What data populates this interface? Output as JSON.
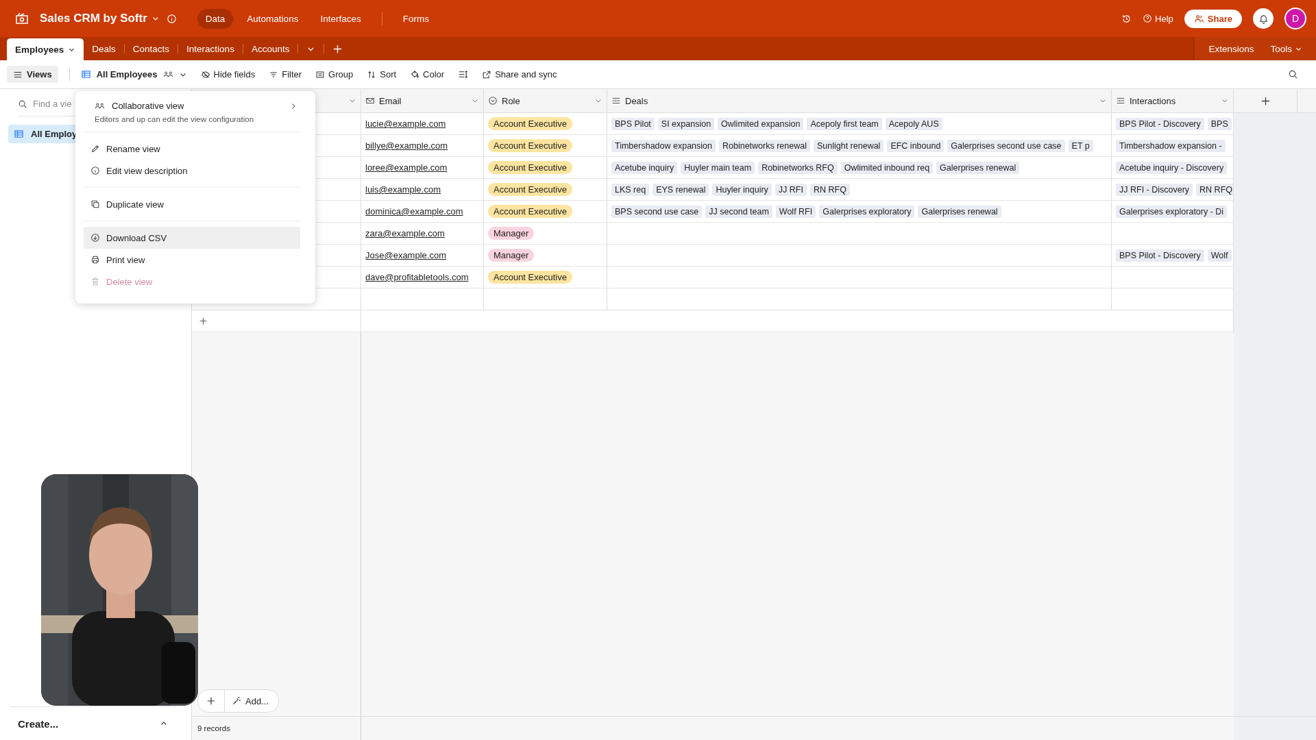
{
  "app": {
    "title": "Sales CRM by Softr"
  },
  "nav": [
    {
      "label": "Data",
      "selected": true
    },
    {
      "label": "Automations",
      "selected": false
    },
    {
      "label": "Interfaces",
      "selected": false
    },
    {
      "label": "Forms",
      "selected": false
    }
  ],
  "top_actions": {
    "help": "Help",
    "share": "Share",
    "avatar": "D"
  },
  "tables": [
    {
      "label": "Employees",
      "selected": true
    },
    {
      "label": "Deals",
      "selected": false
    },
    {
      "label": "Contacts",
      "selected": false
    },
    {
      "label": "Interactions",
      "selected": false
    },
    {
      "label": "Accounts",
      "selected": false
    }
  ],
  "table_tools": {
    "extensions": "Extensions",
    "tools": "Tools"
  },
  "toolbar": {
    "views": "Views",
    "view_name": "All Employees",
    "items": [
      {
        "kind": "hide",
        "label": "Hide fields"
      },
      {
        "kind": "filter",
        "label": "Filter"
      },
      {
        "kind": "group",
        "label": "Group"
      },
      {
        "kind": "sort",
        "label": "Sort"
      },
      {
        "kind": "color",
        "label": "Color"
      },
      {
        "kind": "height"
      },
      {
        "kind": "share",
        "label": "Share and sync"
      }
    ]
  },
  "sidebar": {
    "search_placeholder": "Find a vie",
    "views": [
      {
        "label": "All Employ",
        "selected": true
      }
    ],
    "create": "Create..."
  },
  "view_menu": {
    "title": "Collaborative view",
    "description": "Editors and up can edit the view configuration",
    "groups": [
      [
        {
          "kind": "rename",
          "label": "Rename view",
          "highlighted": false,
          "danger": false
        },
        {
          "kind": "describe",
          "label": "Edit view description",
          "highlighted": false,
          "danger": false
        }
      ],
      [
        {
          "kind": "duplicate",
          "label": "Duplicate view",
          "highlighted": false,
          "danger": false
        }
      ],
      [
        {
          "kind": "download",
          "label": "Download CSV",
          "highlighted": true,
          "danger": false
        },
        {
          "kind": "print",
          "label": "Print view",
          "highlighted": false,
          "danger": false
        },
        {
          "kind": "delete",
          "label": "Delete view",
          "highlighted": false,
          "danger": true
        }
      ]
    ]
  },
  "grid": {
    "columns": [
      {
        "kind": "email",
        "label": "Email"
      },
      {
        "kind": "select",
        "label": "Role"
      },
      {
        "kind": "link",
        "label": "Deals"
      },
      {
        "kind": "link",
        "label": "Interactions"
      }
    ],
    "rows": [
      {
        "email": "lucie@example.com",
        "role": {
          "label": "Account Executive",
          "color": "#fde4a0"
        },
        "deals": [
          "BPS Pilot",
          "SI expansion",
          "Owlimited expansion",
          "Acepoly first team",
          "Acepoly AUS"
        ],
        "interactions": [
          "BPS Pilot - Discovery",
          "BPS"
        ]
      },
      {
        "email": "billye@example.com",
        "role": {
          "label": "Account Executive",
          "color": "#fde4a0"
        },
        "deals": [
          "Timbershadow expansion",
          "Robinetworks renewal",
          "Sunlight renewal",
          "EFC inbound",
          "Galerprises second use case",
          "ET p"
        ],
        "interactions": [
          "Timbershadow expansion -"
        ]
      },
      {
        "email": "loree@example.com",
        "role": {
          "label": "Account Executive",
          "color": "#fde4a0"
        },
        "deals": [
          "Acetube inquiry",
          "Huyler main team",
          "Robinetworks RFQ",
          "Owlimited inbound req",
          "Galerprises renewal"
        ],
        "interactions": [
          "Acetube inquiry - Discovery"
        ]
      },
      {
        "email": "luis@example.com",
        "role": {
          "label": "Account Executive",
          "color": "#fde4a0"
        },
        "deals": [
          "LKS req",
          "EYS renewal",
          "Huyler inquiry",
          "JJ RFI",
          "RN RFQ"
        ],
        "interactions": [
          "JJ RFI - Discovery",
          "RN RFQ"
        ]
      },
      {
        "email": "dominica@example.com",
        "role": {
          "label": "Account Executive",
          "color": "#fde4a0"
        },
        "deals": [
          "BPS second use case",
          "JJ second team",
          "Wolf RFI",
          "Galerprises exploratory",
          "Galerprises renewal"
        ],
        "interactions": [
          "Galerprises exploratory - Di"
        ]
      },
      {
        "email": "zara@example.com",
        "role": {
          "label": "Manager",
          "color": "#fbd3de"
        }
      },
      {
        "email": "Jose@example.com",
        "role": {
          "label": "Manager",
          "color": "#fbd3de"
        },
        "interactions": [
          "BPS Pilot - Discovery",
          "Wolf"
        ]
      },
      {
        "email": "dave@profitabletools.com",
        "role": {
          "label": "Account Executive",
          "color": "#fde4a0"
        }
      },
      {}
    ]
  },
  "footer": {
    "add": "Add...",
    "records": "9 records"
  }
}
